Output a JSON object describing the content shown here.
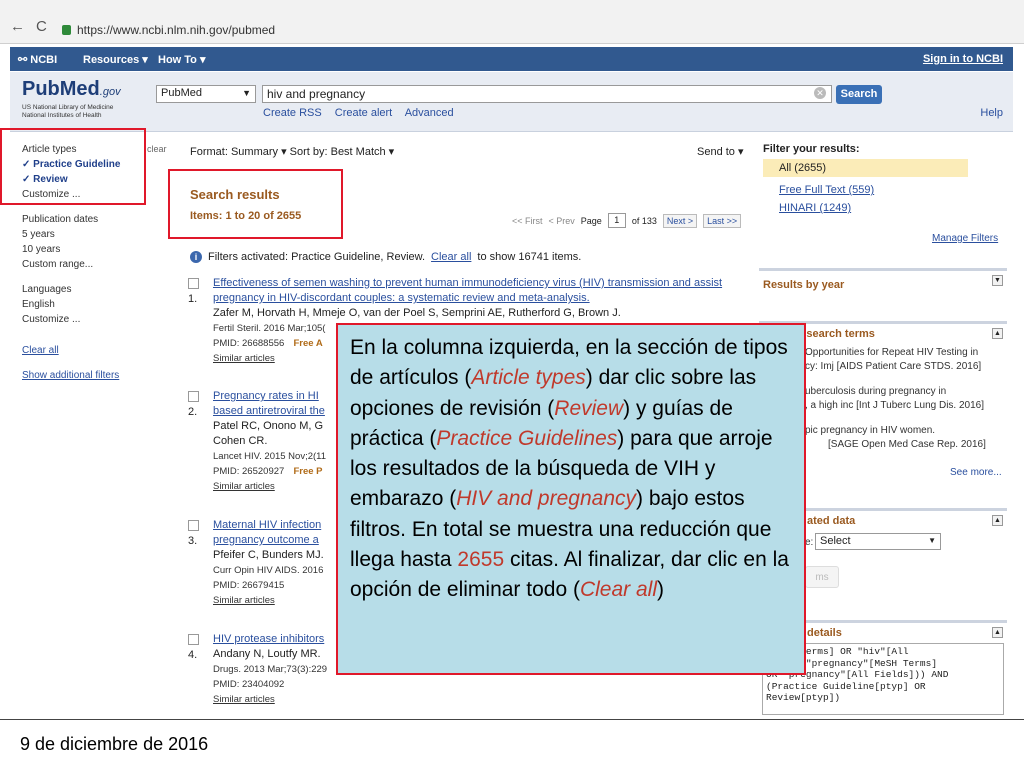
{
  "browser": {
    "back": "←",
    "reload": "C",
    "url": "https://www.ncbi.nlm.nih.gov/pubmed"
  },
  "ncbi_bar": {
    "logo": "NCBI",
    "resources": "Resources ▾",
    "howto": "How To ▾",
    "signin": "Sign in to NCBI"
  },
  "search": {
    "logo_main": "PubMed",
    "logo_gov": ".gov",
    "logo_sub_1": "US National Library of Medicine",
    "logo_sub_2": "National Institutes of Health",
    "database": "PubMed",
    "query": "hiv and pregnancy",
    "button": "Search",
    "links": [
      "Create RSS",
      "Create alert",
      "Advanced"
    ],
    "help": "Help"
  },
  "sidebar": {
    "clear": "clear",
    "article_types": "Article types",
    "practice_guideline": "✓ Practice Guideline",
    "review": "✓ Review",
    "customize": "Customize ...",
    "pub_dates": "Publication dates",
    "five_years": "5 years",
    "ten_years": "10 years",
    "custom_range": "Custom range...",
    "languages": "Languages",
    "english": "English",
    "customize2": "Customize ...",
    "clear_all": "Clear all",
    "show_additional": "Show additional filters"
  },
  "results": {
    "format": "Format: Summary ▾   Sort by: Best Match ▾",
    "send_to": "Send to ▾",
    "title": "Search results",
    "items": "Items: 1 to 20 of 2655",
    "pager_first": "<< First",
    "pager_prev": "< Prev",
    "pager_page": "Page",
    "pager_num": "1",
    "pager_of": "of 133",
    "pager_next": "Next >",
    "pager_last": "Last >>",
    "filters_activated": "Filters activated: Practice Guideline, Review.",
    "filters_clear": "Clear all",
    "filters_tail": "to show 16741 items.",
    "list": [
      {
        "num": "1.",
        "title_a": "Effectiveness of semen washing to prevent human immunodeficiency virus (HIV) transmission and assist pregnancy in HIV-discordant couples: a systematic review and meta-analysis.",
        "authors": "Zafer M, Horvath H, Mmeje O, van der Poel S, Semprini AE, Rutherford G, Brown J.",
        "journal": "Fertil Steril. 2016 Mar;105(",
        "pmid": "PMID: 26688556",
        "free": "Free A",
        "similar": "Similar articles"
      },
      {
        "num": "2.",
        "title_a": "Pregnancy rates in HI",
        "title_b": "based antiretroviral the",
        "authors": "Patel RC, Onono M, G",
        "authors2": "Cohen CR.",
        "journal": "Lancet HIV. 2015 Nov;2(11",
        "pmid": "PMID: 26520927",
        "free": "Free P",
        "similar": "Similar articles"
      },
      {
        "num": "3.",
        "title_a": "Maternal HIV infection",
        "title_b": "pregnancy outcome a",
        "authors": "Pfeifer C, Bunders MJ.",
        "journal": "Curr Opin HIV AIDS. 2016",
        "pmid": "PMID: 26679415",
        "similar": "Similar articles"
      },
      {
        "num": "4.",
        "title_a": "HIV protease inhibitors",
        "authors": "Andany N, Loutfy MR.",
        "journal": "Drugs. 2013 Mar;73(3):229",
        "pmid": "PMID: 23404092",
        "similar": "Similar articles"
      }
    ]
  },
  "right": {
    "filter_title": "Filter your results:",
    "all": "All (2655)",
    "free_full": "Free Full Text (559)",
    "hinari": "HINARI (1249)",
    "manage": "Manage Filters",
    "by_year": "Results by year",
    "search_terms": "ith your search terms",
    "r1a": "Opportunities for Repeat HIV Testing in",
    "r1b": "cy: Imj [AIDS Patient Care STDS. 2016]",
    "r2a": "uberculosis during pregnancy in",
    "r2b": ", a high inc [Int J Tuberc Lung Dis. 2016]",
    "r3a": "pic pregnancy in HIV women.",
    "r3b": "[SAGE Open Med Case Rep. 2016]",
    "see_more": "See more...",
    "related": "ated data",
    "select_label": "e:",
    "select_value": "Select",
    "items_btn": "ms",
    "details": "details",
    "query": "[MeSH Terms] OR \"hiv\"[All\n) AND (\"pregnancy\"[MeSH Terms]\nOR \"pregnancy\"[All Fields])) AND\n(Practice Guideline[ptyp] OR\nReview[ptyp])"
  },
  "callout": {
    "t1": "En la columna izquierda, en la sección de tipos de artículos (",
    "i1": "Article types",
    "t2": ") dar clic sobre las opciones de revisión (",
    "i2": "Review",
    "t3": ") y guías de práctica (",
    "i3": "Practice Guidelines",
    "t4": ") para que arroje los resultados de la búsqueda de VIH y embarazo (",
    "i4": "HIV and pregnancy",
    "t5": ") bajo estos filtros. En total se muestra una reducción que llega hasta ",
    "n1": "2655",
    "t6": " citas. Al finalizar, dar clic en la opción de eliminar todo (",
    "i5": "Clear all",
    "t7": ")"
  },
  "footer": {
    "date": "9 de diciembre de 2016"
  }
}
